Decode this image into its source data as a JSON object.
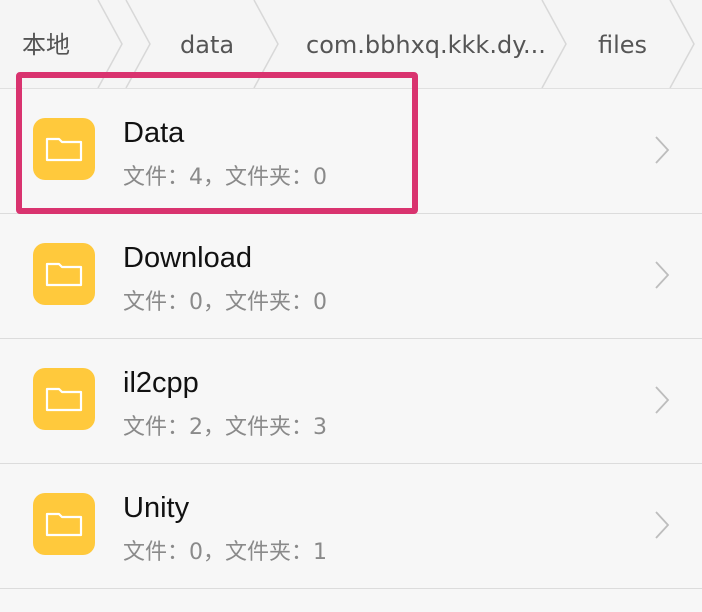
{
  "breadcrumb": {
    "items": [
      {
        "label": "本地"
      },
      {
        "label": "data"
      },
      {
        "label": "com.bbhxq.kkk.dy..."
      },
      {
        "label": "files"
      }
    ]
  },
  "folders": [
    {
      "name": "Data",
      "meta": "文件：4，文件夹：0"
    },
    {
      "name": "Download",
      "meta": "文件：0，文件夹：0"
    },
    {
      "name": "il2cpp",
      "meta": "文件：2，文件夹：3"
    },
    {
      "name": "Unity",
      "meta": "文件：0，文件夹：1"
    }
  ],
  "icons": {
    "folder": "folder-icon",
    "chevron": "chevron-right-icon"
  },
  "colors": {
    "folder": "#ffc93c",
    "highlight": "#d9336f"
  }
}
